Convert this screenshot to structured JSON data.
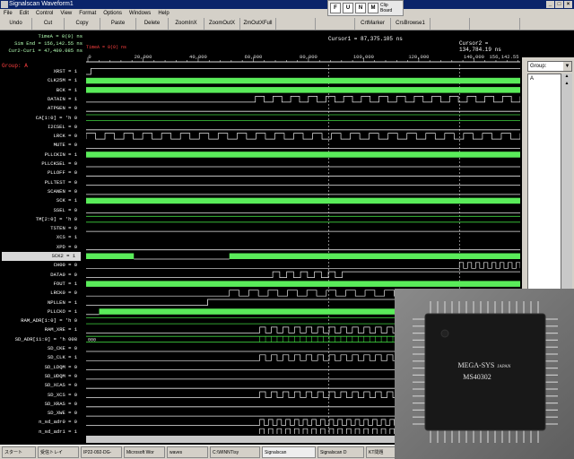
{
  "window": {
    "title": "Signalscan Waveform1"
  },
  "menu": [
    "File",
    "Edit",
    "Control",
    "View",
    "Format",
    "Options",
    "Windows",
    "Help"
  ],
  "toolbar": [
    {
      "label": "Undo",
      "enabled": true
    },
    {
      "label": "Cut",
      "enabled": true
    },
    {
      "label": "Copy",
      "enabled": true
    },
    {
      "label": "Paste",
      "enabled": true
    },
    {
      "label": "Delete",
      "enabled": true
    },
    {
      "label": "ZoomInX",
      "enabled": true
    },
    {
      "label": "ZoomOutX",
      "enabled": true
    },
    {
      "label": "ZmOutXFull",
      "enabled": true
    },
    {
      "label": "",
      "enabled": false
    },
    {
      "label": "",
      "enabled": false
    },
    {
      "label": "CrtMarker",
      "enabled": true
    },
    {
      "label": "CrsBrowse1",
      "enabled": true
    },
    {
      "label": "",
      "enabled": false
    },
    {
      "label": "",
      "enabled": false
    }
  ],
  "float_toolbar": {
    "items": [
      "F",
      "U",
      "N",
      "M"
    ],
    "caption": "Clip Board"
  },
  "header": {
    "time_a": "TimeA = 0(0) ns",
    "sim_end": "Sim End = 156,142.55 ns",
    "cur2_cur1": "Cur2-Cur1 = 47,409.085 ns",
    "cursor1": "Cursor1 = 87,375.105 ns",
    "cursor2": "Cursor2 = 134,784.19 ns",
    "time_red": "TimeA = 0(0) ns",
    "axis_ticks": [
      "0",
      "20,000",
      "40,000",
      "60,000",
      "80,000",
      "100,000",
      "120,000",
      "140,000",
      "156,142.55"
    ],
    "axis_max": 156142.55,
    "cursor1_t": 87375.105,
    "cursor2_t": 134784.19
  },
  "group_label": "Group: A",
  "side_panel": {
    "combo": "Group:",
    "items": [
      "A"
    ]
  },
  "signals": [
    {
      "name": "XRST = 1",
      "fill": false,
      "wave": "p0.011"
    },
    {
      "name": "CLK25M = 1",
      "fill": true
    },
    {
      "name": "BCK = 1",
      "fill": true
    },
    {
      "name": "DATAIN = 1",
      "fill": false,
      "wave": "t0.39-1.0-30"
    },
    {
      "name": "ATPGEN = 0",
      "fill": false
    },
    {
      "name": "CA[1:0] = 'h 0",
      "fill": false,
      "bus": true
    },
    {
      "name": "I2CSEL = 0",
      "fill": false
    },
    {
      "name": "LRCK = 0",
      "fill": false,
      "wave": "c0.0-1.0-46"
    },
    {
      "name": "MUTE = 0",
      "fill": false
    },
    {
      "name": "PLLCKIN = 1",
      "fill": true
    },
    {
      "name": "PLLCKSEL = 0",
      "fill": false
    },
    {
      "name": "PLLOFF = 0",
      "fill": false
    },
    {
      "name": "PLLTEST = 0",
      "fill": false
    },
    {
      "name": "SCANEN = 0",
      "fill": false
    },
    {
      "name": "SCK = 1",
      "fill": true
    },
    {
      "name": "SSEL = 0",
      "fill": false
    },
    {
      "name": "TM[2:0] = 'h 0",
      "fill": false,
      "bus": true
    },
    {
      "name": "TSTEN = 0",
      "fill": false
    },
    {
      "name": "XCS = 1",
      "fill": false,
      "wave": "pulses"
    },
    {
      "name": "XPD = 0",
      "fill": false
    },
    {
      "name": "SCK2 = 1",
      "fill": true,
      "sel": true,
      "partial": true
    },
    {
      "name": "CH00 = 0",
      "fill": false,
      "wave": "t0.86-1.0-15"
    },
    {
      "name": "DATA0 = 0",
      "fill": false,
      "wave": "t0.43-0.59-10"
    },
    {
      "name": "FOUT = 1",
      "fill": true
    },
    {
      "name": "LRCK0 = 0",
      "fill": false,
      "wave": "t0.33-1.0-30"
    },
    {
      "name": "NPLLEN = 1",
      "fill": false,
      "wave": "p0.28-1"
    },
    {
      "name": "PLLCKO = 1",
      "fill": true,
      "late": true
    },
    {
      "name": "RAM_ADR[1:0] = 'h 0",
      "fill": false,
      "bus": true
    },
    {
      "name": "RAM_XRE = 1",
      "fill": false,
      "wave": "t0.40-1.0-45"
    },
    {
      "name": "SD_ADR[11:0] = 'h 008",
      "fill": false,
      "bus": true,
      "label": "000",
      "wave": "t0.40-1.0-45"
    },
    {
      "name": "SD_CKE = 0",
      "fill": false
    },
    {
      "name": "SD_CLK = 1",
      "fill": false,
      "wave": "t0.40-1.0-45"
    },
    {
      "name": "SD_LDQM = 0",
      "fill": false
    },
    {
      "name": "SD_UDQM = 0",
      "fill": false
    },
    {
      "name": "SD_XCAS = 0",
      "fill": false
    },
    {
      "name": "SD_XCS = 0",
      "fill": false,
      "wave": "t0.40-1.0-45"
    },
    {
      "name": "SD_XRAS = 0",
      "fill": false
    },
    {
      "name": "SD_XWE = 0",
      "fill": false
    },
    {
      "name": "n_sd_adr0 = 0",
      "fill": false,
      "wave": "t0.40-1.0-60"
    },
    {
      "name": "n_sd_adr1 = 1",
      "fill": false,
      "wave": "t0.40-1.0-60"
    }
  ],
  "taskbar": [
    {
      "label": "スタート"
    },
    {
      "label": "受信トレイ"
    },
    {
      "label": "IP22-092-DG-"
    },
    {
      "label": "Microsoft Wor"
    },
    {
      "label": "waves"
    },
    {
      "label": "C:\\WINNT\\sy"
    },
    {
      "label": "Signalscan"
    },
    {
      "label": "Signalscan D"
    },
    {
      "label": "KT問題"
    }
  ],
  "photo": {
    "brand": "MEGA-SYS",
    "origin": "JAPAN",
    "part": "MS40302"
  }
}
